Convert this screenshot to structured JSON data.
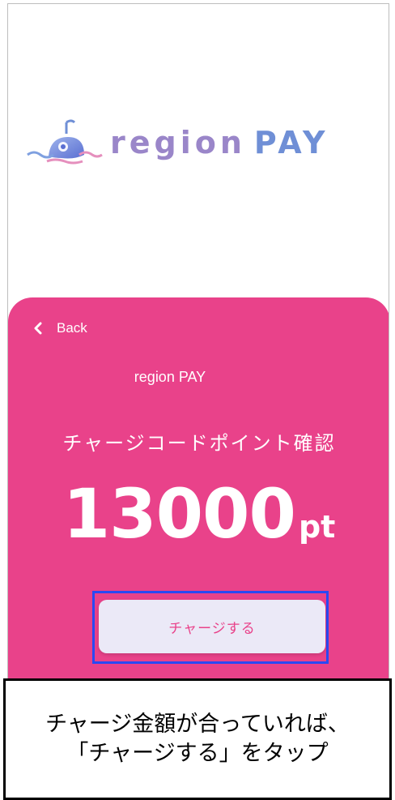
{
  "colors": {
    "accent": "#e9428a",
    "button_bg": "#ebe9f7",
    "highlight_border": "#2b49f2",
    "logo_text": "#9a86c9"
  },
  "logo": {
    "icon": "whale-logo-icon",
    "text_part1": "region",
    "text_part2": "PAY"
  },
  "sheet": {
    "back_icon": "chevron-left-icon",
    "back_label": "Back",
    "service_name": "region PAY",
    "title": "チャージコードポイント確認",
    "amount_value": "13000",
    "amount_unit": "pt",
    "charge_button_label": "チャージする"
  },
  "caption": {
    "line1": "チャージ金額が合っていれば、",
    "line2": "「チャージする」をタップ"
  }
}
